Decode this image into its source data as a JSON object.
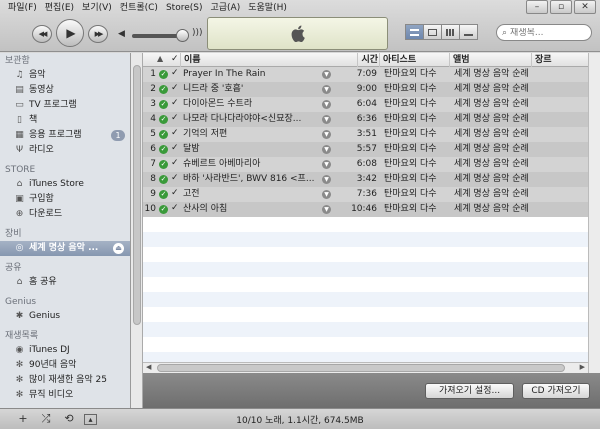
{
  "menu": [
    "파일(F)",
    "편집(E)",
    "보기(V)",
    "컨트롤(C)",
    "Store(S)",
    "고급(A)",
    "도움말(H)"
  ],
  "window_buttons": [
    "–",
    "▫",
    "✕"
  ],
  "search": {
    "placeholder": "재생목..."
  },
  "sidebar": {
    "library_header": "보관함",
    "library": [
      {
        "label": "음악",
        "icon": "music-note-icon"
      },
      {
        "label": "동영상",
        "icon": "film-icon"
      },
      {
        "label": "TV 프로그램",
        "icon": "tv-icon"
      },
      {
        "label": "책",
        "icon": "book-icon"
      },
      {
        "label": "응용 프로그램",
        "icon": "apps-icon",
        "badge": "1"
      },
      {
        "label": "라디오",
        "icon": "radio-icon"
      }
    ],
    "store_header": "STORE",
    "store": [
      {
        "label": "iTunes Store",
        "icon": "store-icon"
      },
      {
        "label": "구입함",
        "icon": "purchased-icon"
      },
      {
        "label": "다운로드",
        "icon": "download-icon"
      }
    ],
    "devices_header": "장비",
    "devices": [
      {
        "label": "세계 명상 음악 ...",
        "icon": "cd-icon"
      }
    ],
    "shared_header": "공유",
    "shared": [
      {
        "label": "홈 공유",
        "icon": "home-icon"
      }
    ],
    "genius_header": "Genius",
    "genius": [
      {
        "label": "Genius",
        "icon": "genius-icon"
      }
    ],
    "playlists_header": "재생목록",
    "playlists": [
      {
        "label": "iTunes DJ",
        "icon": "dj-icon"
      },
      {
        "label": "90년대 음악",
        "icon": "gear-icon"
      },
      {
        "label": "많이 재생한 음악 25",
        "icon": "gear-icon"
      },
      {
        "label": "뮤직 비디오",
        "icon": "gear-icon"
      }
    ]
  },
  "table": {
    "headers": {
      "name": "이름",
      "time": "시간",
      "artist": "아티스트",
      "album": "앨범",
      "genre": "장르"
    },
    "rows": [
      {
        "num": "1",
        "name": "Prayer In The Rain",
        "time": "7:09",
        "artist": "탄마요외 다수",
        "album": "세계 명상 음악 순례"
      },
      {
        "num": "2",
        "name": "니드라 중 '호흡'",
        "time": "9:00",
        "artist": "탄마요외 다수",
        "album": "세계 명상 음악 순례"
      },
      {
        "num": "3",
        "name": "다이아몬드 수트라",
        "time": "6:04",
        "artist": "탄마요외 다수",
        "album": "세계 명상 음악 순례"
      },
      {
        "num": "4",
        "name": "나모라 다나다라야야<신묘장...",
        "time": "6:36",
        "artist": "탄마요외 다수",
        "album": "세계 명상 음악 순례"
      },
      {
        "num": "5",
        "name": "기억의 저편",
        "time": "3:51",
        "artist": "탄마요외 다수",
        "album": "세계 명상 음악 순례"
      },
      {
        "num": "6",
        "name": "달밤",
        "time": "5:57",
        "artist": "탄마요외 다수",
        "album": "세계 명상 음악 순례"
      },
      {
        "num": "7",
        "name": "슈베르트 아베마리아",
        "time": "6:08",
        "artist": "탄마요외 다수",
        "album": "세계 명상 음악 순례"
      },
      {
        "num": "8",
        "name": "바하 '사라반드', BWV 816 <프...",
        "time": "3:42",
        "artist": "탄마요외 다수",
        "album": "세계 명상 음악 순례"
      },
      {
        "num": "9",
        "name": "고전",
        "time": "7:36",
        "artist": "탄마요외 다수",
        "album": "세계 명상 음악 순례"
      },
      {
        "num": "10",
        "name": "산사의 아침",
        "time": "10:46",
        "artist": "탄마요외 다수",
        "album": "세계 명상 음악 순례"
      }
    ]
  },
  "buttons": {
    "import_settings": "가져오기 설정...",
    "import_cd": "CD 가져오기"
  },
  "status": {
    "summary": "10/10 노래, 1.1시간, 674.5MB"
  },
  "colors": {
    "selected_sidebar": "#8697b0",
    "check_green": "#3a9a3a"
  }
}
